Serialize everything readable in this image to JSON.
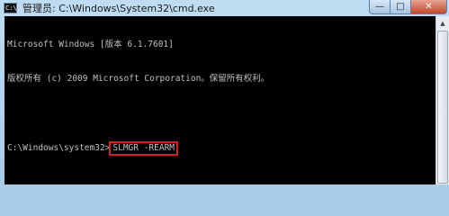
{
  "window": {
    "title": "管理员: C:\\Windows\\System32\\cmd.exe",
    "icon_label": "C:\\"
  },
  "controls": {
    "minimize": "—",
    "maximize": "□",
    "close": "✕"
  },
  "console": {
    "line1": "Microsoft Windows [版本 6.1.7601]",
    "line2": "版权所有 (c) 2009 Microsoft Corporation。保留所有权利。",
    "line3": "",
    "prompt": "C:\\Windows\\system32>",
    "command": "SLMGR -REARM"
  },
  "scrollbar": {
    "up_arrow": "▲"
  },
  "colors": {
    "console_bg": "#000000",
    "console_text": "#c0c0c0",
    "highlight_border": "#d81e1e"
  }
}
